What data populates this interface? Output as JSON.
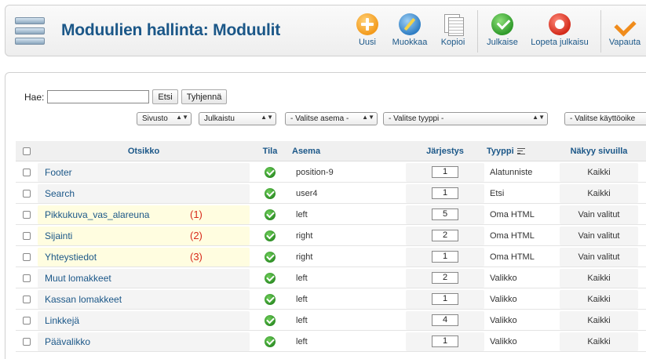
{
  "toolbar": {
    "title": "Moduulien hallinta: Moduulit",
    "buttons": {
      "new": "Uusi",
      "edit": "Muokkaa",
      "copy": "Kopioi",
      "publish": "Julkaise",
      "unpublish": "Lopeta julkaisu",
      "unlock": "Vapauta"
    }
  },
  "search": {
    "label": "Hae:",
    "value": "",
    "search_button": "Etsi",
    "clear_button": "Tyhjennä"
  },
  "filters": {
    "site": "Sivusto",
    "state": "Julkaistu",
    "position": "- Valitse asema -",
    "type": "- Valitse tyyppi -",
    "access": "- Valitse käyttöoike"
  },
  "columns": {
    "title": "Otsikko",
    "status": "Tila",
    "position": "Asema",
    "order": "Järjestys",
    "type": "Tyyppi",
    "pages": "Näkyy sivuilla"
  },
  "rows": [
    {
      "title": "Footer",
      "marker": "",
      "position": "position-9",
      "order": "1",
      "type": "Alatunniste",
      "pages": "Kaikki"
    },
    {
      "title": "Search",
      "marker": "",
      "position": "user4",
      "order": "1",
      "type": "Etsi",
      "pages": "Kaikki"
    },
    {
      "title": "Pikkukuva_vas_alareuna",
      "marker": "(1)",
      "position": "left",
      "order": "5",
      "type": "Oma HTML",
      "pages": "Vain valitut"
    },
    {
      "title": "Sijainti",
      "marker": "(2)",
      "position": "right",
      "order": "2",
      "type": "Oma HTML",
      "pages": "Vain valitut"
    },
    {
      "title": "Yhteystiedot",
      "marker": "(3)",
      "position": "right",
      "order": "1",
      "type": "Oma HTML",
      "pages": "Vain valitut"
    },
    {
      "title": "Muut lomakkeet",
      "marker": "",
      "position": "left",
      "order": "2",
      "type": "Valikko",
      "pages": "Kaikki"
    },
    {
      "title": "Kassan lomakkeet",
      "marker": "",
      "position": "left",
      "order": "1",
      "type": "Valikko",
      "pages": "Kaikki"
    },
    {
      "title": "Linkkejä",
      "marker": "",
      "position": "left",
      "order": "4",
      "type": "Valikko",
      "pages": "Kaikki"
    },
    {
      "title": "Päävalikko",
      "marker": "",
      "position": "left",
      "order": "1",
      "type": "Valikko",
      "pages": "Kaikki"
    }
  ],
  "colors": {
    "title_blue": "#1b5788",
    "marker_red": "#d82a1a",
    "highlight": "#fffde0"
  }
}
